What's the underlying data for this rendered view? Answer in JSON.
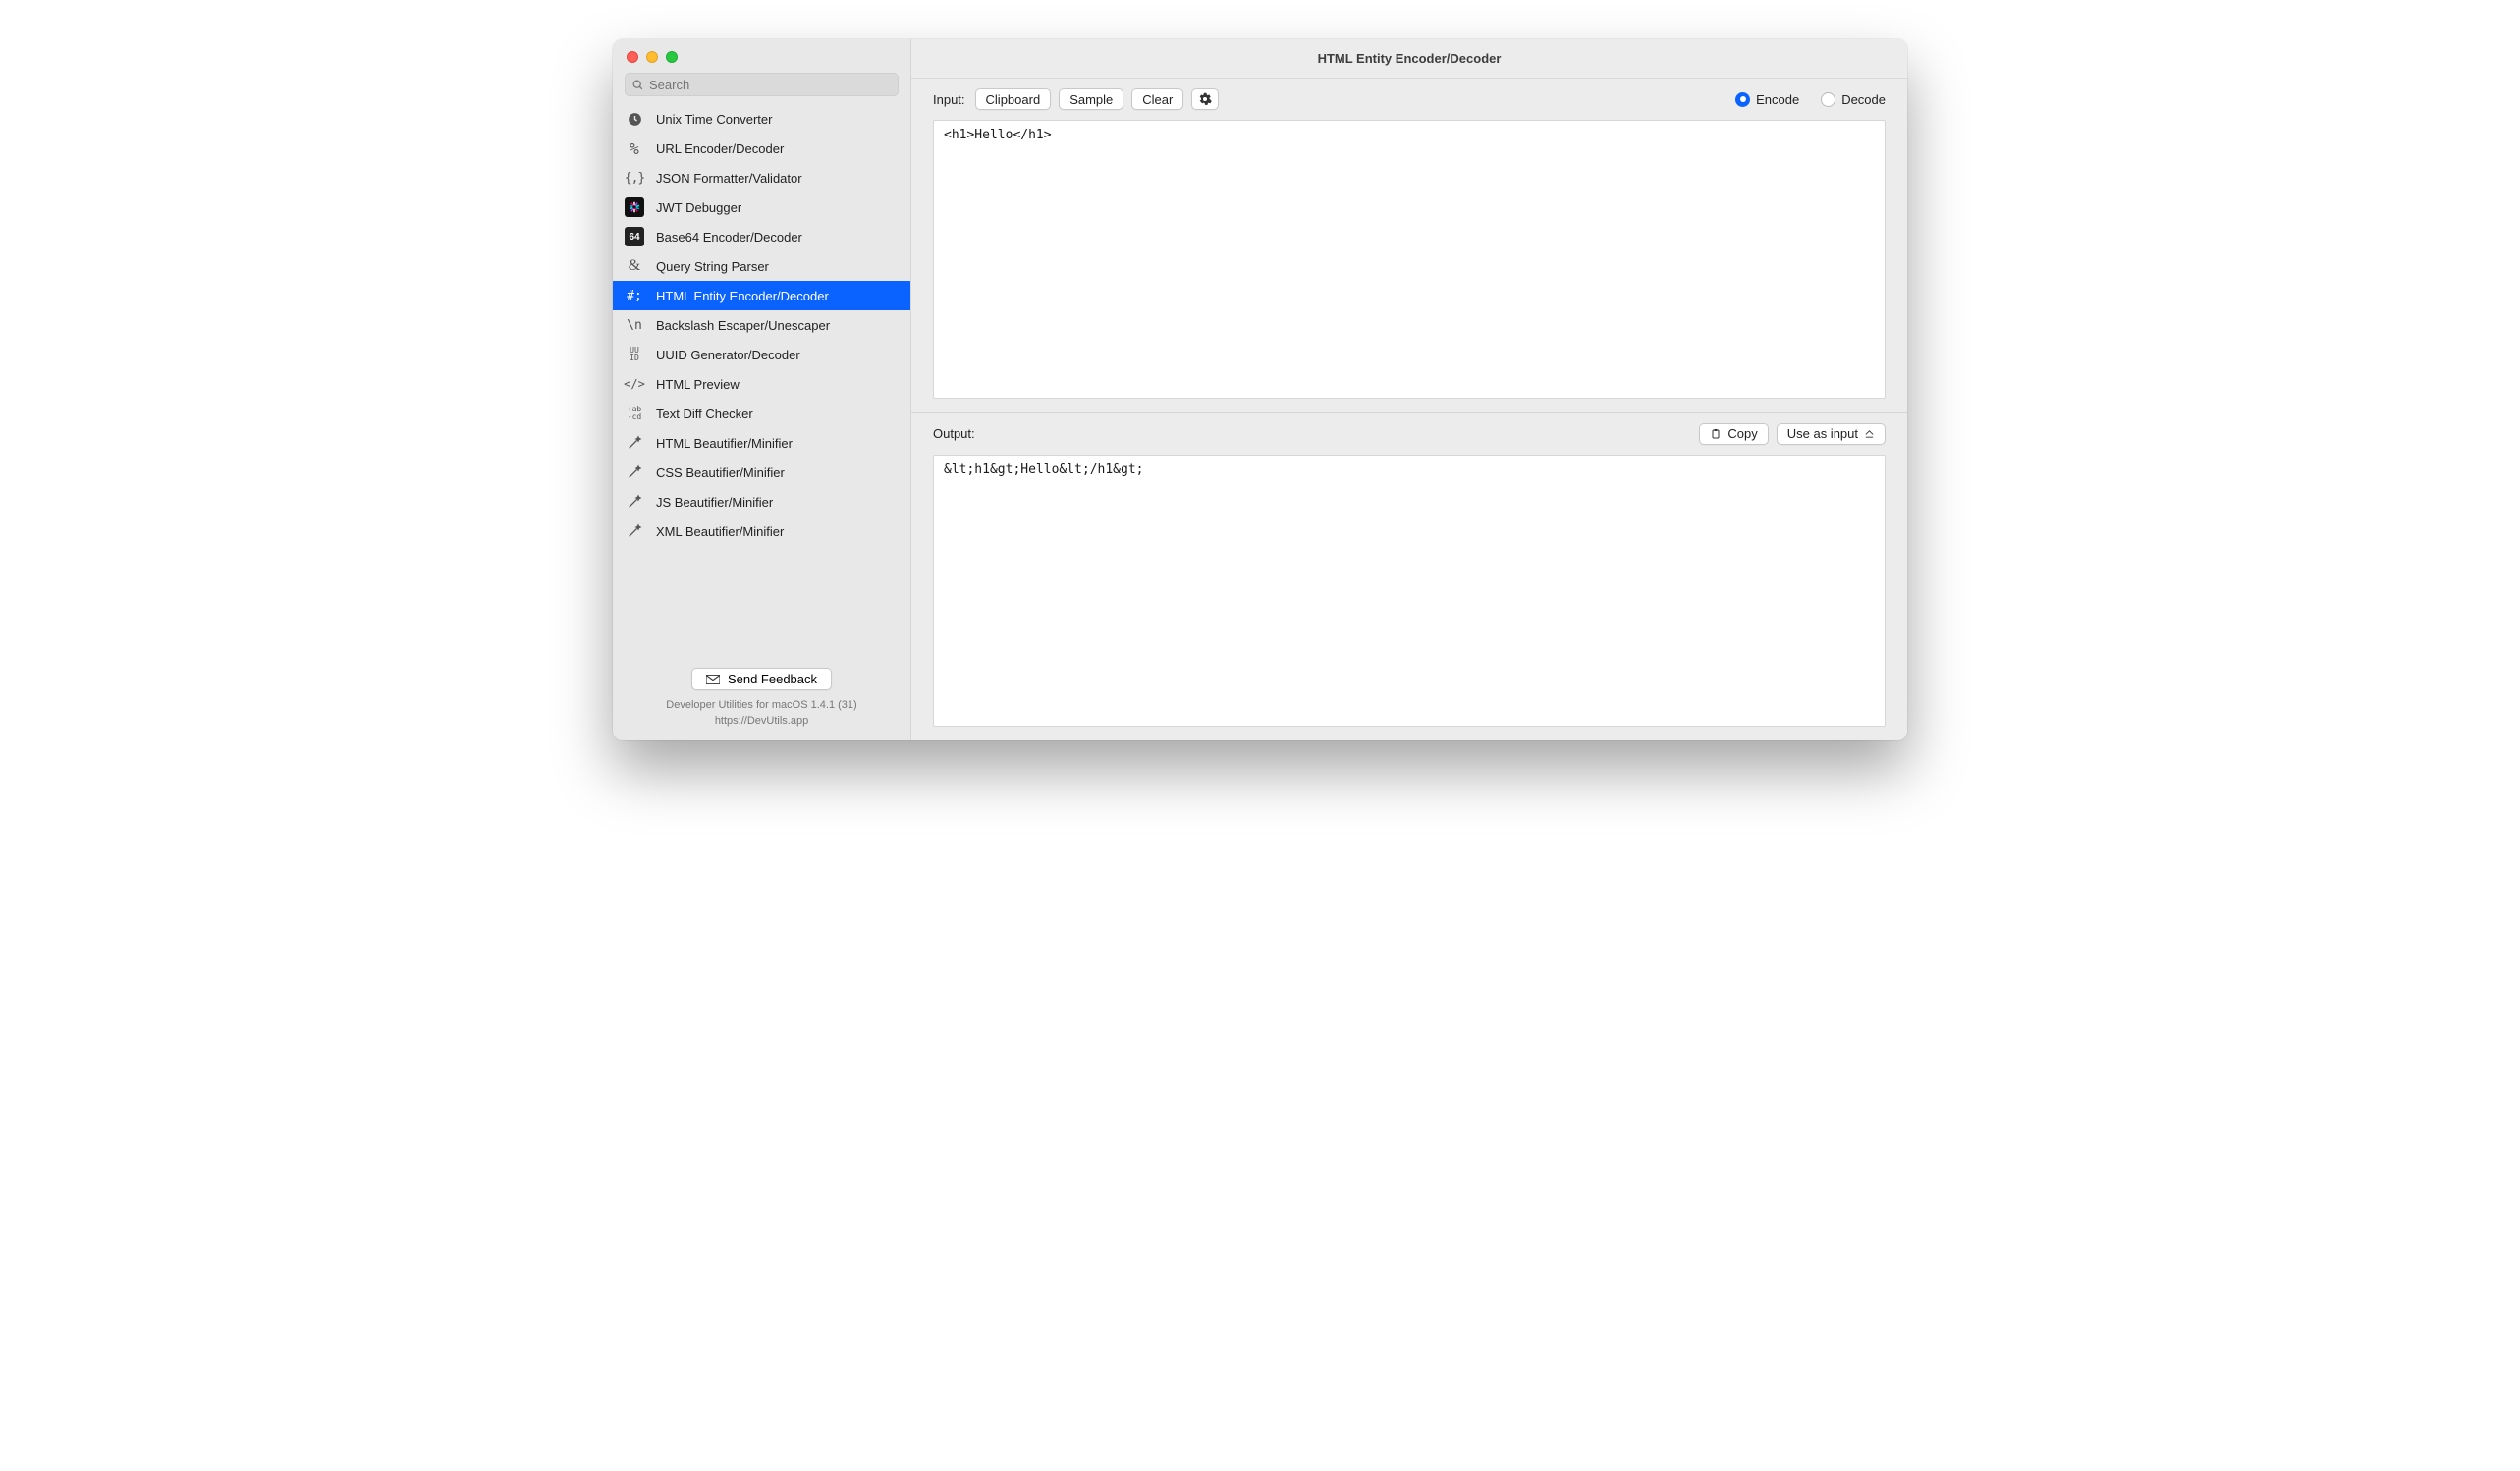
{
  "window_title": "HTML Entity Encoder/Decoder",
  "search": {
    "placeholder": "Search"
  },
  "sidebar": {
    "items": [
      {
        "label": "Unix Time Converter",
        "icon": "clock-icon"
      },
      {
        "label": "URL Encoder/Decoder",
        "icon": "percent-icon"
      },
      {
        "label": "JSON Formatter/Validator",
        "icon": "braces-icon"
      },
      {
        "label": "JWT Debugger",
        "icon": "jwt-icon"
      },
      {
        "label": "Base64 Encoder/Decoder",
        "icon": "b64-icon"
      },
      {
        "label": "Query String Parser",
        "icon": "ampersand-icon"
      },
      {
        "label": "HTML Entity Encoder/Decoder",
        "icon": "entity-icon",
        "selected": true
      },
      {
        "label": "Backslash Escaper/Unescaper",
        "icon": "backslash-icon"
      },
      {
        "label": "UUID Generator/Decoder",
        "icon": "uuid-icon"
      },
      {
        "label": "HTML Preview",
        "icon": "tag-icon"
      },
      {
        "label": "Text Diff Checker",
        "icon": "diff-icon"
      },
      {
        "label": "HTML Beautifier/Minifier",
        "icon": "wand-icon"
      },
      {
        "label": "CSS Beautifier/Minifier",
        "icon": "wand-icon"
      },
      {
        "label": "JS Beautifier/Minifier",
        "icon": "wand-icon"
      },
      {
        "label": "XML Beautifier/Minifier",
        "icon": "wand-icon"
      }
    ]
  },
  "footer": {
    "feedback": "Send Feedback",
    "line1": "Developer Utilities for macOS 1.4.1 (31)",
    "line2": "https://DevUtils.app"
  },
  "input": {
    "label": "Input:",
    "buttons": {
      "clipboard": "Clipboard",
      "sample": "Sample",
      "clear": "Clear"
    },
    "mode": {
      "encode": "Encode",
      "decode": "Decode",
      "selected": "encode"
    },
    "text": "<h1>Hello</h1>"
  },
  "output": {
    "label": "Output:",
    "buttons": {
      "copy": "Copy",
      "use_as_input": "Use as input"
    },
    "text": "&lt;h1&gt;Hello&lt;/h1&gt;"
  }
}
